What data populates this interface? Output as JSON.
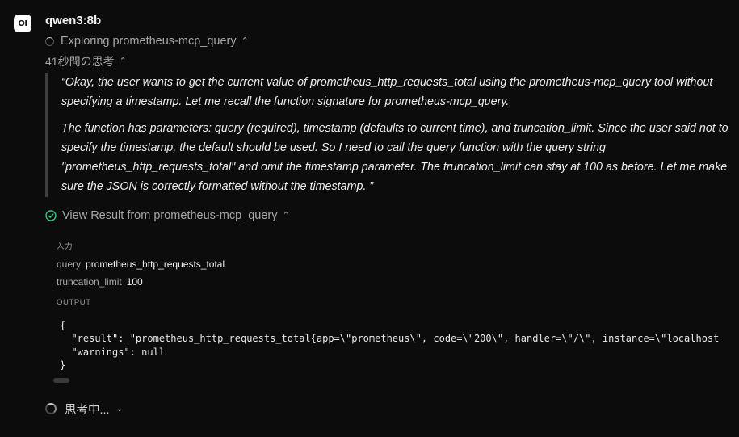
{
  "message": {
    "avatar_text": "OI",
    "model_name": "qwen3:8b",
    "status": {
      "icon": "spinner-icon",
      "label": "Exploring prometheus-mcp_query",
      "chevron": "⌃"
    },
    "thinking": {
      "label": "41秒間の思考",
      "chevron": "⌃",
      "paragraphs": [
        "“Okay, the user wants to get the current value of prometheus_http_requests_total using the prometheus-mcp_query tool without specifying a timestamp. Let me recall the function signature for prometheus-mcp_query.",
        "The function has parameters: query (required), timestamp (defaults to current time), and truncation_limit. Since the user said not to specify the timestamp, the default should be used. So I need to call the query function with the query string \"prometheus_http_requests_total\" and omit the timestamp parameter. The truncation_limit can stay at 100 as before. Let me make sure the JSON is correctly formatted without the timestamp. ”"
      ]
    },
    "tool_result": {
      "icon": "check-circle-icon",
      "label": "View Result from prometheus-mcp_query",
      "chevron": "⌃",
      "input_heading": "入力",
      "params": [
        {
          "key": "query",
          "value": "prometheus_http_requests_total"
        },
        {
          "key": "truncation_limit",
          "value": "100"
        }
      ],
      "output_heading": "OUTPUT",
      "output_lines": [
        "{",
        "  \"result\": \"prometheus_http_requests_total{app=\\\"prometheus\\\", code=\\\"200\\\", handler=\\\"/\\\", instance=\\\"localhost",
        "  \"warnings\": null",
        "}"
      ]
    },
    "footer_status": {
      "icon": "spinner-icon",
      "label": "思考中...",
      "chevron": "⌄"
    }
  },
  "colors": {
    "background": "#0c0c0c",
    "success_green": "#34c77b"
  }
}
